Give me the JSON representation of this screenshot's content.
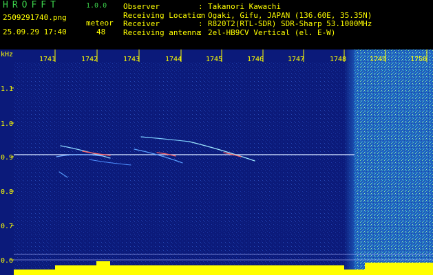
{
  "header": {
    "app_name": "HROFFT",
    "version": "1.0.0",
    "filename": "2509291740.png",
    "meteor_label": "meteor",
    "datetime": "25.09.29 17:40",
    "meteor_count": "48",
    "info": [
      {
        "key": "Observer",
        "value": "Takanori Kawachi"
      },
      {
        "key": "Receiving Location",
        "value": "Ogaki, Gifu, JAPAN (136.60E, 35.35N)"
      },
      {
        "key": "Receiver",
        "value": "R820T2(RTL-SDR) SDR-Sharp 53.1000MHz"
      },
      {
        "key": "Receiving antenna",
        "value": "2el-HB9CV Vertical (el. E-W)"
      }
    ]
  },
  "spectrogram": {
    "y_unit": "kHz",
    "x_ticks": [
      "1741",
      "1742",
      "1743",
      "1744",
      "1745",
      "1746",
      "1747",
      "1748",
      "1749",
      "1750"
    ],
    "y_ticks": [
      "1.1",
      "1.0",
      "0.9",
      "0.8",
      "0.7",
      "0.6"
    ],
    "colors": {
      "background": "#0b1a7a",
      "labels": "#ffff00",
      "signal_line": "#d0e0ff",
      "noise_band": "#3fbfd0",
      "level_bars": "#ffff00"
    }
  }
}
